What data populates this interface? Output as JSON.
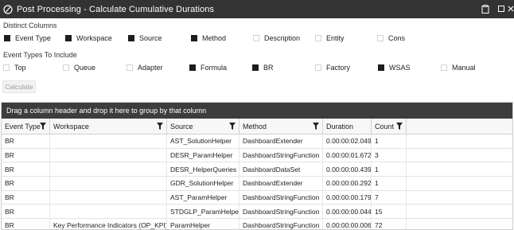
{
  "window": {
    "title": "Post Processing - Calculate Cumulative Durations",
    "icons": {
      "app": "circle-slash-icon",
      "clipboard": "clipboard-icon",
      "maximize": "maximize-icon",
      "close": "close-icon"
    }
  },
  "distinct_columns": {
    "label": "Distinct Columns",
    "options": [
      {
        "label": "Event Type",
        "checked": true
      },
      {
        "label": "Workspace",
        "checked": true
      },
      {
        "label": "Source",
        "checked": true
      },
      {
        "label": "Method",
        "checked": true
      },
      {
        "label": "Description",
        "checked": false
      },
      {
        "label": "Entity",
        "checked": false
      },
      {
        "label": "Cons",
        "checked": false
      }
    ]
  },
  "event_types": {
    "label": "Event Types To Include",
    "options": [
      {
        "label": "Top",
        "checked": false
      },
      {
        "label": "Queue",
        "checked": false
      },
      {
        "label": "Adapter",
        "checked": false
      },
      {
        "label": "Formula",
        "checked": true
      },
      {
        "label": "BR",
        "checked": true
      },
      {
        "label": "Factory",
        "checked": false
      },
      {
        "label": "WSAS",
        "checked": true
      },
      {
        "label": "Manual",
        "checked": false
      }
    ]
  },
  "calculate_button": "Calculate",
  "grid": {
    "group_panel_text": "Drag a column header and drop it here to group by that column",
    "columns": [
      "Event Type",
      "Workspace",
      "Source",
      "Method",
      "Duration",
      "Count"
    ],
    "rows": [
      [
        "BR",
        "",
        "AST_SolutionHelper",
        "DashboardExtender",
        "0.00:00:02.049",
        "1"
      ],
      [
        "BR",
        "",
        "DESR_ParamHelper",
        "DashboardStringFunction",
        "0.00:00:01.672",
        "3"
      ],
      [
        "BR",
        "",
        "DESR_HelperQueries",
        "DashboardDataSet",
        "0.00:00:00.439",
        "1"
      ],
      [
        "BR",
        "",
        "GDR_SolutionHelper",
        "DashboardExtender",
        "0.00:00:00.292",
        "1"
      ],
      [
        "BR",
        "",
        "AST_ParamHelper",
        "DashboardStringFunction",
        "0.00:00:00.179",
        "7"
      ],
      [
        "BR",
        "",
        "STDGLP_ParamHelper",
        "DashboardStringFunction",
        "0.00:00:00.044",
        "15"
      ],
      [
        "BR",
        "Key Performance Indicators (OP_KPI)",
        "ParamHelper",
        "DashboardStringFunction",
        "0.00:00:00.006",
        "72"
      ]
    ]
  }
}
